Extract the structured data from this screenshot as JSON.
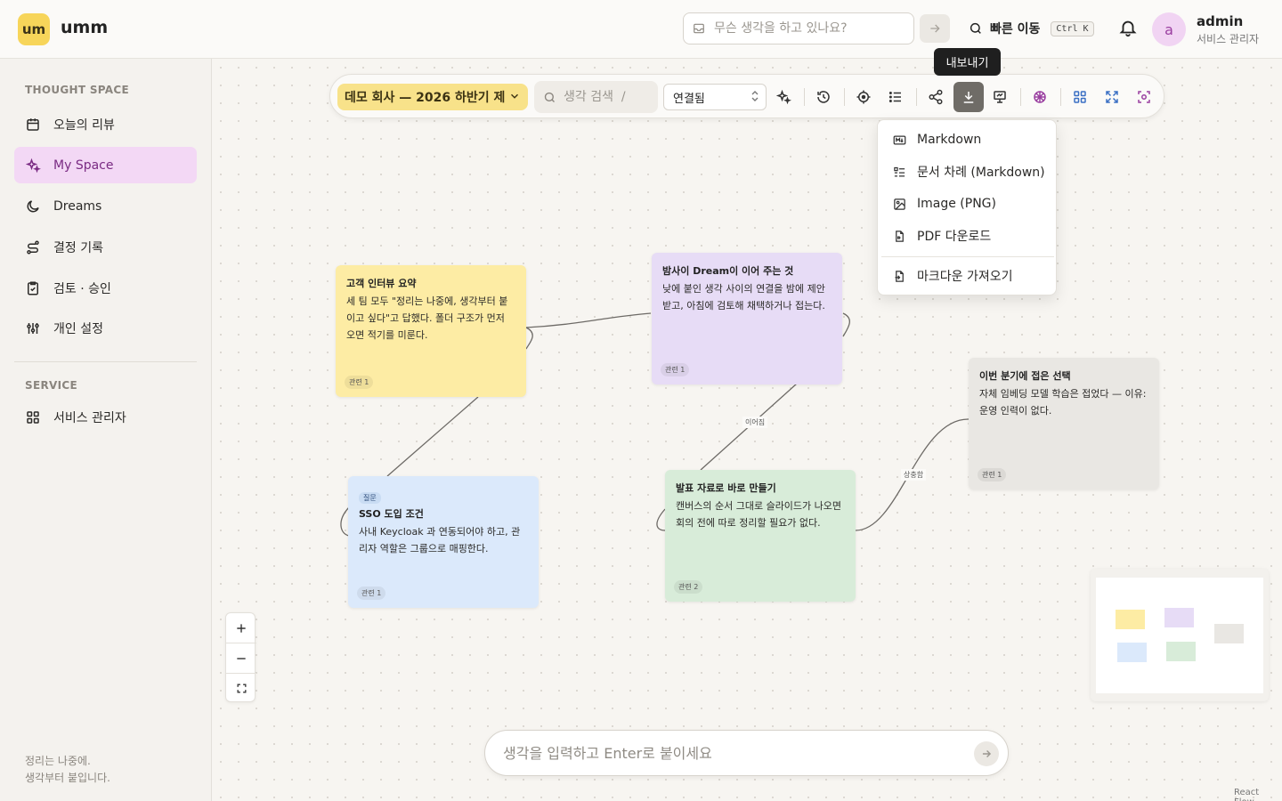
{
  "brand": {
    "logo_text": "um",
    "name": "umm"
  },
  "header": {
    "quick_input_placeholder": "무슨 생각을 하고 있나요?",
    "quick_move_label": "빠른 이동",
    "shortcut": "Ctrl K",
    "user": {
      "avatar_letter": "a",
      "name": "admin",
      "role": "서비스 관리자"
    }
  },
  "sidebar": {
    "section_thought": "THOUGHT SPACE",
    "items": [
      {
        "label": "오늘의 리뷰",
        "icon": "calendar-icon"
      },
      {
        "label": "My Space",
        "icon": "sparkles-icon",
        "active": true
      },
      {
        "label": "Dreams",
        "icon": "moon-icon"
      },
      {
        "label": "결정 기록",
        "icon": "route-icon"
      },
      {
        "label": "검토 · 승인",
        "icon": "clipboard-check-icon"
      },
      {
        "label": "개인 설정",
        "icon": "sliders-icon"
      }
    ],
    "section_service": "SERVICE",
    "service_items": [
      {
        "label": "서비스 관리자",
        "icon": "grid-icon"
      }
    ],
    "tagline_line1": "정리는 나중에.",
    "tagline_line2": "생각부터 붙입니다."
  },
  "toolbar": {
    "space_name": "데모 회사 — 2026 하반기 제",
    "search_placeholder": "생각 검색  /",
    "filter_value": "연결됨",
    "tooltip": "내보내기"
  },
  "export_menu": {
    "items": [
      {
        "label": "Markdown",
        "icon": "markdown-icon"
      },
      {
        "label": "문서 차례 (Markdown)",
        "icon": "list-icon"
      },
      {
        "label": "Image (PNG)",
        "icon": "image-icon"
      },
      {
        "label": "PDF 다운로드",
        "icon": "pdf-icon"
      }
    ],
    "import_label": "마크다운 가져오기"
  },
  "nodes": [
    {
      "title": "고객 인터뷰 요약",
      "body": "세 팀 모두 \"정리는 나중에, 생각부터 붙이고 싶다\"고 답했다. 폴더 구조가 먼저 오면 적기를 미룬다.",
      "tag": "관련 1",
      "color": "#fdeca4"
    },
    {
      "title": "밤사이 Dream이 이어 주는 것",
      "body": "낮에 붙인 생각 사이의 연결을 밤에 제안받고, 아침에 검토해 채택하거나 접는다.",
      "tag": "관련 1",
      "color": "#e7dcf6"
    },
    {
      "chip": "질문",
      "title": "SSO 도입 조건",
      "body": "사내 Keycloak 과 연동되어야 하고, 관리자 역할은 그룹으로 매핑한다.",
      "tag": "관련 1",
      "color": "#dbe9fb"
    },
    {
      "title": "발표 자료로 바로 만들기",
      "body": "캔버스의 순서 그대로 슬라이드가 나오면 회의 전에 따로 정리할 필요가 없다.",
      "tag": "관련 2",
      "color": "#d8ecd9"
    },
    {
      "title": "이번 분기에 접은 선택",
      "body": "자체 임베딩 모델 학습은 접었다 — 이유: 운영 인력이 없다.",
      "tag": "관련 1",
      "color": "#e9e7e3"
    }
  ],
  "edges": {
    "label_connected": "이어짐",
    "label_conflict": "상충함"
  },
  "bottom": {
    "placeholder": "생각을 입력하고 Enter로 붙이세요"
  },
  "attribution": "React Flow"
}
